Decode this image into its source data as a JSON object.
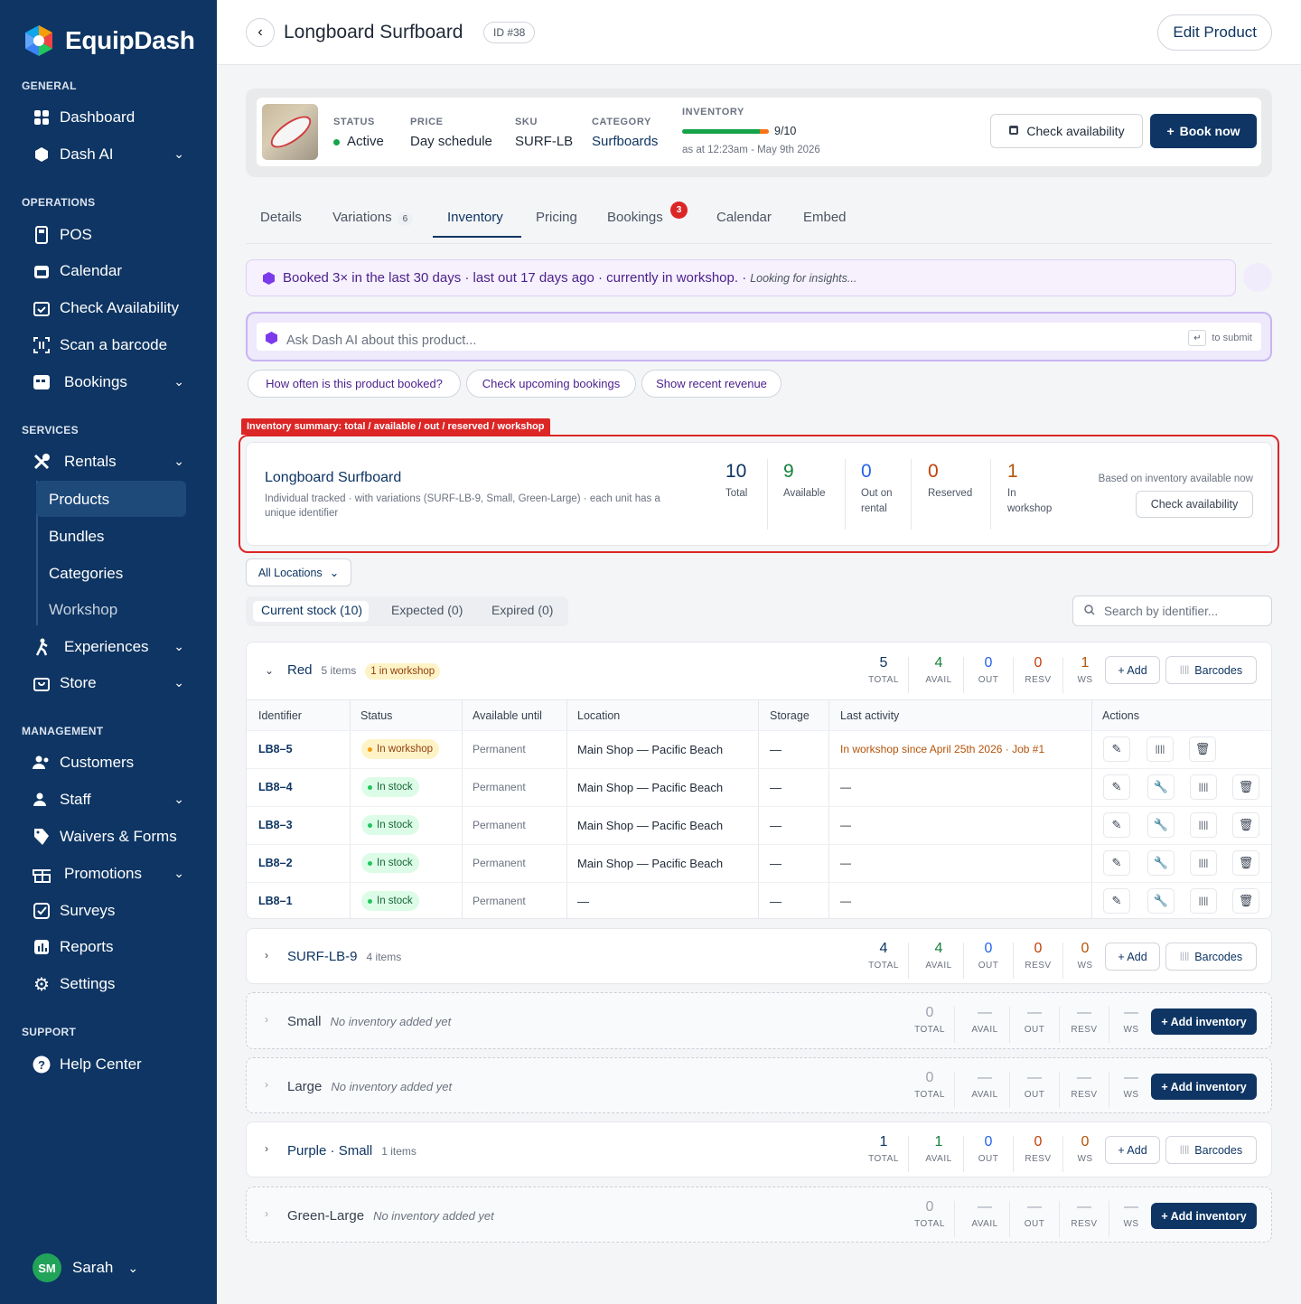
{
  "brand": {
    "name": "EquipDash"
  },
  "sidebar": {
    "sections": {
      "general": "GENERAL",
      "operations": "OPERATIONS",
      "services": "SERVICES",
      "management": "MANAGEMENT",
      "support": "SUPPORT"
    },
    "items": {
      "dashboard": "Dashboard",
      "dash_ai": "Dash AI",
      "pos": "POS",
      "calendar": "Calendar",
      "check_availability": "Check Availability",
      "scan_barcode": "Scan a barcode",
      "bookings": "Bookings",
      "rentals": "Rentals",
      "products": "Products",
      "bundles": "Bundles",
      "categories": "Categories",
      "workshop": "Workshop",
      "experiences": "Experiences",
      "store": "Store",
      "customers": "Customers",
      "staff": "Staff",
      "waivers": "Waivers & Forms",
      "promotions": "Promotions",
      "surveys": "Surveys",
      "reports": "Reports",
      "settings": "Settings",
      "help": "Help Center"
    },
    "user": {
      "initials": "SM",
      "name": "Sarah"
    }
  },
  "header": {
    "title": "Longboard Surfboard",
    "id_badge": "ID #38",
    "edit_button": "Edit Product"
  },
  "summary": {
    "status_label": "STATUS",
    "status_value": "Active",
    "price_label": "PRICE",
    "price_value": "Day schedule",
    "sku_label": "SKU",
    "sku_value": "SURF-LB",
    "category_label": "CATEGORY",
    "category_value": "Surfboards",
    "inventory_label": "INVENTORY",
    "inventory_value": "9/10",
    "inventory_fraction": 0.9,
    "inventory_note": "as at 12:23am - May 9th 2026",
    "check_button": "Check availability",
    "book_button": "Book now",
    "colors": {
      "active": "#16a34a",
      "bar": "#16a34a",
      "bar_end": "#f97316"
    }
  },
  "tabs": {
    "details": "Details",
    "variations": "Variations",
    "variations_count": "6",
    "inventory": "Inventory",
    "pricing": "Pricing",
    "bookings": "Bookings",
    "bookings_alert": "3",
    "calendar": "Calendar",
    "embed": "Embed"
  },
  "insight": {
    "text": "Booked 3× in the last 30 days · last out 17 days ago · currently in workshop. ·",
    "muted": "Looking for insights..."
  },
  "ai": {
    "placeholder": "Ask Dash AI about this product...",
    "submit_hint": "to submit",
    "chips": [
      "How often is this product booked?",
      "Check upcoming bookings",
      "Show recent revenue"
    ]
  },
  "inventory_summary": {
    "tag": "Inventory summary: total / available / out / reserved / workshop",
    "title": "Longboard Surfboard",
    "description": "Individual tracked · with variations (SURF-LB-9, Small, Green-Large) · each unit has a unique identifier",
    "stats": [
      {
        "value": "10",
        "label": "Total",
        "color": "#0e3563"
      },
      {
        "value": "9",
        "label": "Available",
        "color": "#15803d"
      },
      {
        "value": "0",
        "label": "Out on rental",
        "color": "#2563eb"
      },
      {
        "value": "0",
        "label": "Reserved",
        "color": "#c2410c"
      },
      {
        "value": "1",
        "label": "In workshop",
        "color": "#b45309"
      }
    ],
    "note": "Based on inventory available now",
    "check_button": "Check availability"
  },
  "filters": {
    "locations": "All Locations",
    "stock_tabs": [
      "Current stock (10)",
      "Expected (0)",
      "Expired (0)"
    ],
    "search_placeholder": "Search by identifier..."
  },
  "stat_labels": [
    "TOTAL",
    "AVAIL",
    "OUT",
    "RESV",
    "WS"
  ],
  "buttons": {
    "add": "+ Add",
    "barcodes": "Barcodes",
    "add_inventory": "+ Add inventory"
  },
  "table": {
    "columns": [
      "Identifier",
      "Status",
      "Available until",
      "Location",
      "Storage",
      "Last activity",
      "Actions"
    ],
    "rows": [
      {
        "id": "LB8–5",
        "status": "In workshop",
        "until": "Permanent",
        "location": "Main Shop — Pacific Beach",
        "storage": "—",
        "activity": "In workshop since April 25th 2026 · Job #1"
      },
      {
        "id": "LB8–4",
        "status": "In stock",
        "until": "Permanent",
        "location": "Main Shop — Pacific Beach",
        "storage": "—",
        "activity": "—"
      },
      {
        "id": "LB8–3",
        "status": "In stock",
        "until": "Permanent",
        "location": "Main Shop — Pacific Beach",
        "storage": "—",
        "activity": "—"
      },
      {
        "id": "LB8–2",
        "status": "In stock",
        "until": "Permanent",
        "location": "Main Shop — Pacific Beach",
        "storage": "—",
        "activity": "—"
      },
      {
        "id": "LB8–1",
        "status": "In stock",
        "until": "Permanent",
        "location": "—",
        "storage": "—",
        "activity": "—"
      }
    ]
  },
  "groups": [
    {
      "name": "Red",
      "count": "5 items",
      "badge": "1 in workshop",
      "stats": [
        "5",
        "4",
        "0",
        "0",
        "1"
      ]
    },
    {
      "name": "SURF-LB-9",
      "count": "4 items",
      "stats": [
        "4",
        "4",
        "0",
        "0",
        "0"
      ]
    },
    {
      "name": "Small",
      "empty": "No inventory added yet",
      "stats": [
        "0",
        "—",
        "—",
        "—",
        "—"
      ]
    },
    {
      "name": "Large",
      "empty": "No inventory added yet",
      "stats": [
        "0",
        "—",
        "—",
        "—",
        "—"
      ]
    },
    {
      "name": "Purple · Small",
      "count": "1 items",
      "stats": [
        "1",
        "1",
        "0",
        "0",
        "0"
      ]
    },
    {
      "name": "Green-Large",
      "empty": "No inventory added yet",
      "stats": [
        "0",
        "—",
        "—",
        "—",
        "—"
      ]
    }
  ],
  "stat_colors": [
    "#0e3563",
    "#15803d",
    "#2563eb",
    "#c2410c",
    "#b45309"
  ]
}
